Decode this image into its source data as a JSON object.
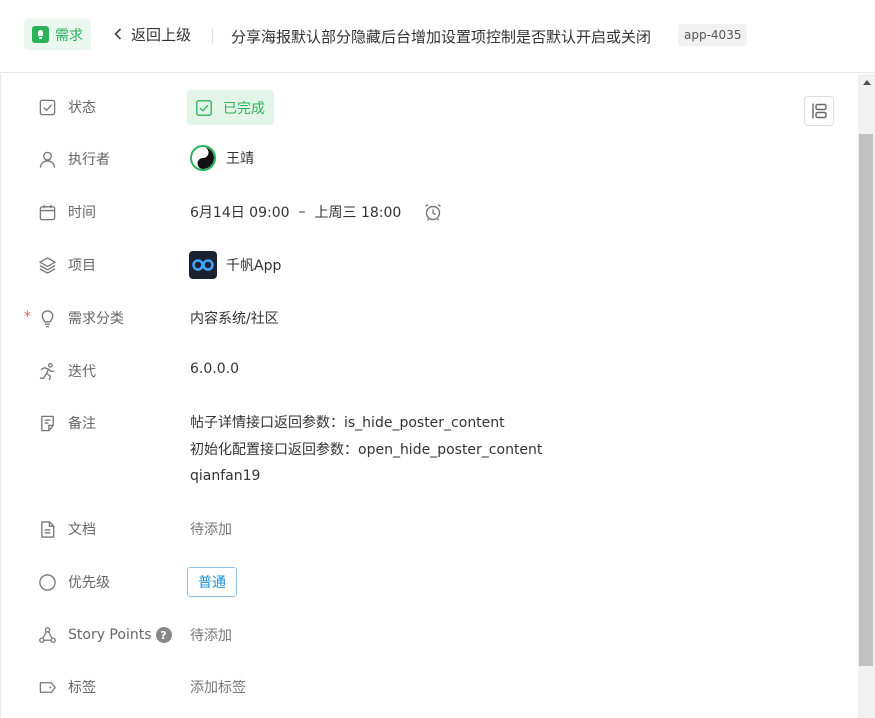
{
  "header": {
    "type_label": "需求",
    "back_label": "返回上级",
    "title": "分享海报默认部分隐藏后台增加设置项控制是否默认开启或关闭",
    "id": "app-4035"
  },
  "fields": {
    "status": {
      "label": "状态",
      "value": "已完成",
      "icon": "checkbox-icon"
    },
    "assignee": {
      "label": "执行者",
      "value": "王靖",
      "icon": "user-icon"
    },
    "time": {
      "label": "时间",
      "start": "6月14日 09:00",
      "separator": "–",
      "end": "上周三 18:00",
      "icon": "calendar-icon"
    },
    "project": {
      "label": "项目",
      "value": "千帆App",
      "icon": "layers-icon"
    },
    "category": {
      "label": "需求分类",
      "required_mark": "*",
      "value": "内容系统/社区",
      "icon": "bulb-icon"
    },
    "iteration": {
      "label": "迭代",
      "value": "6.0.0.0",
      "icon": "running-icon"
    },
    "notes": {
      "label": "备注",
      "lines": [
        "帖子详情接口返回参数：is_hide_poster_content",
        "初始化配置接口返回参数：open_hide_poster_content",
        "qianfan19"
      ],
      "icon": "note-icon"
    },
    "docs": {
      "label": "文档",
      "value": "待添加",
      "icon": "document-icon"
    },
    "priority": {
      "label": "优先级",
      "value": "普通",
      "icon": "circle-icon"
    },
    "story_points": {
      "label": "Story Points",
      "help": "?",
      "value": "待添加",
      "icon": "nodes-icon"
    },
    "tags": {
      "label": "标签",
      "value": "添加标签",
      "icon": "tag-icon"
    }
  },
  "colors": {
    "accent_green": "#2bb35a",
    "priority_blue": "#1e90d6",
    "required_red": "#e85a5a"
  }
}
